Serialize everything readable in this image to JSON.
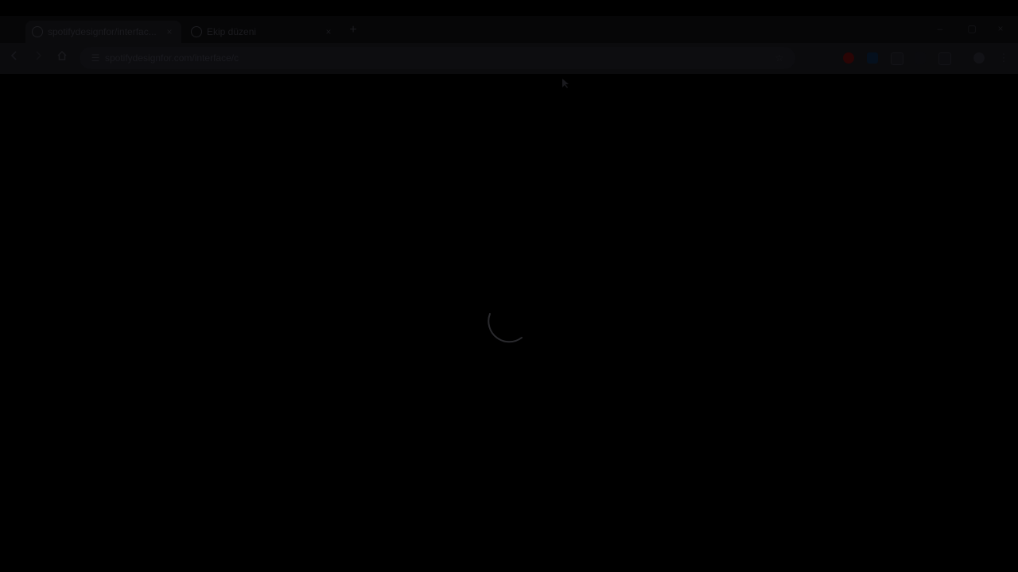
{
  "browser": {
    "tabs": [
      {
        "title": "spotifydesignfor/interfac...",
        "close": "×",
        "active": true
      },
      {
        "title": "Ekip düzeni",
        "close": "×",
        "active": false
      }
    ],
    "new_tab": "+",
    "window_controls": {
      "minimize": "–",
      "maximize": "▢",
      "close": "×"
    }
  },
  "toolbar": {
    "back_icon": "arrow-left-icon",
    "forward_icon": "arrow-right-icon",
    "home_icon": "home-icon",
    "site_info_icon": "tune-icon",
    "address": "spotifydesignfor.com/interface/c"
  },
  "extensions": [
    {
      "name": "red-extension-icon",
      "color": "#2a0505"
    },
    {
      "name": "blue-extension-icon",
      "color": "#05101d"
    },
    {
      "name": "square-extension-icon",
      "color": "#0d0d10"
    },
    {
      "name": "pen-extension-icon",
      "color": "#0b0b0e"
    },
    {
      "name": "puzzle-extension-icon",
      "color": "#0c0c0f"
    }
  ],
  "content": {
    "state": "loading"
  },
  "theme": {
    "background": "#000000",
    "chrome": "#0b0b0d",
    "spinner": "#2a2a2e"
  }
}
